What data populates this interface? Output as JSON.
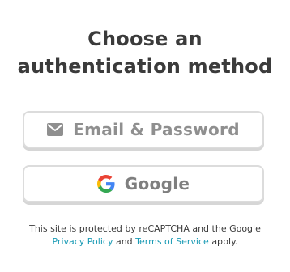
{
  "heading": {
    "line1": "Choose an",
    "line2": "authentication method"
  },
  "buttons": {
    "email": {
      "label": "Email & Password",
      "icon": "envelope-icon"
    },
    "google": {
      "label": "Google",
      "icon": "google-g-icon"
    }
  },
  "legal": {
    "prefix": "This site is protected by reCAPTCHA and the Google",
    "privacy_link": "Privacy Policy",
    "and": "and",
    "terms_link": "Terms of Service",
    "suffix": "apply."
  },
  "colors": {
    "text": "#3b3b3b",
    "button_text": "#8a8a8a",
    "button_border": "#dcdcdc",
    "link": "#1a9bb5"
  }
}
